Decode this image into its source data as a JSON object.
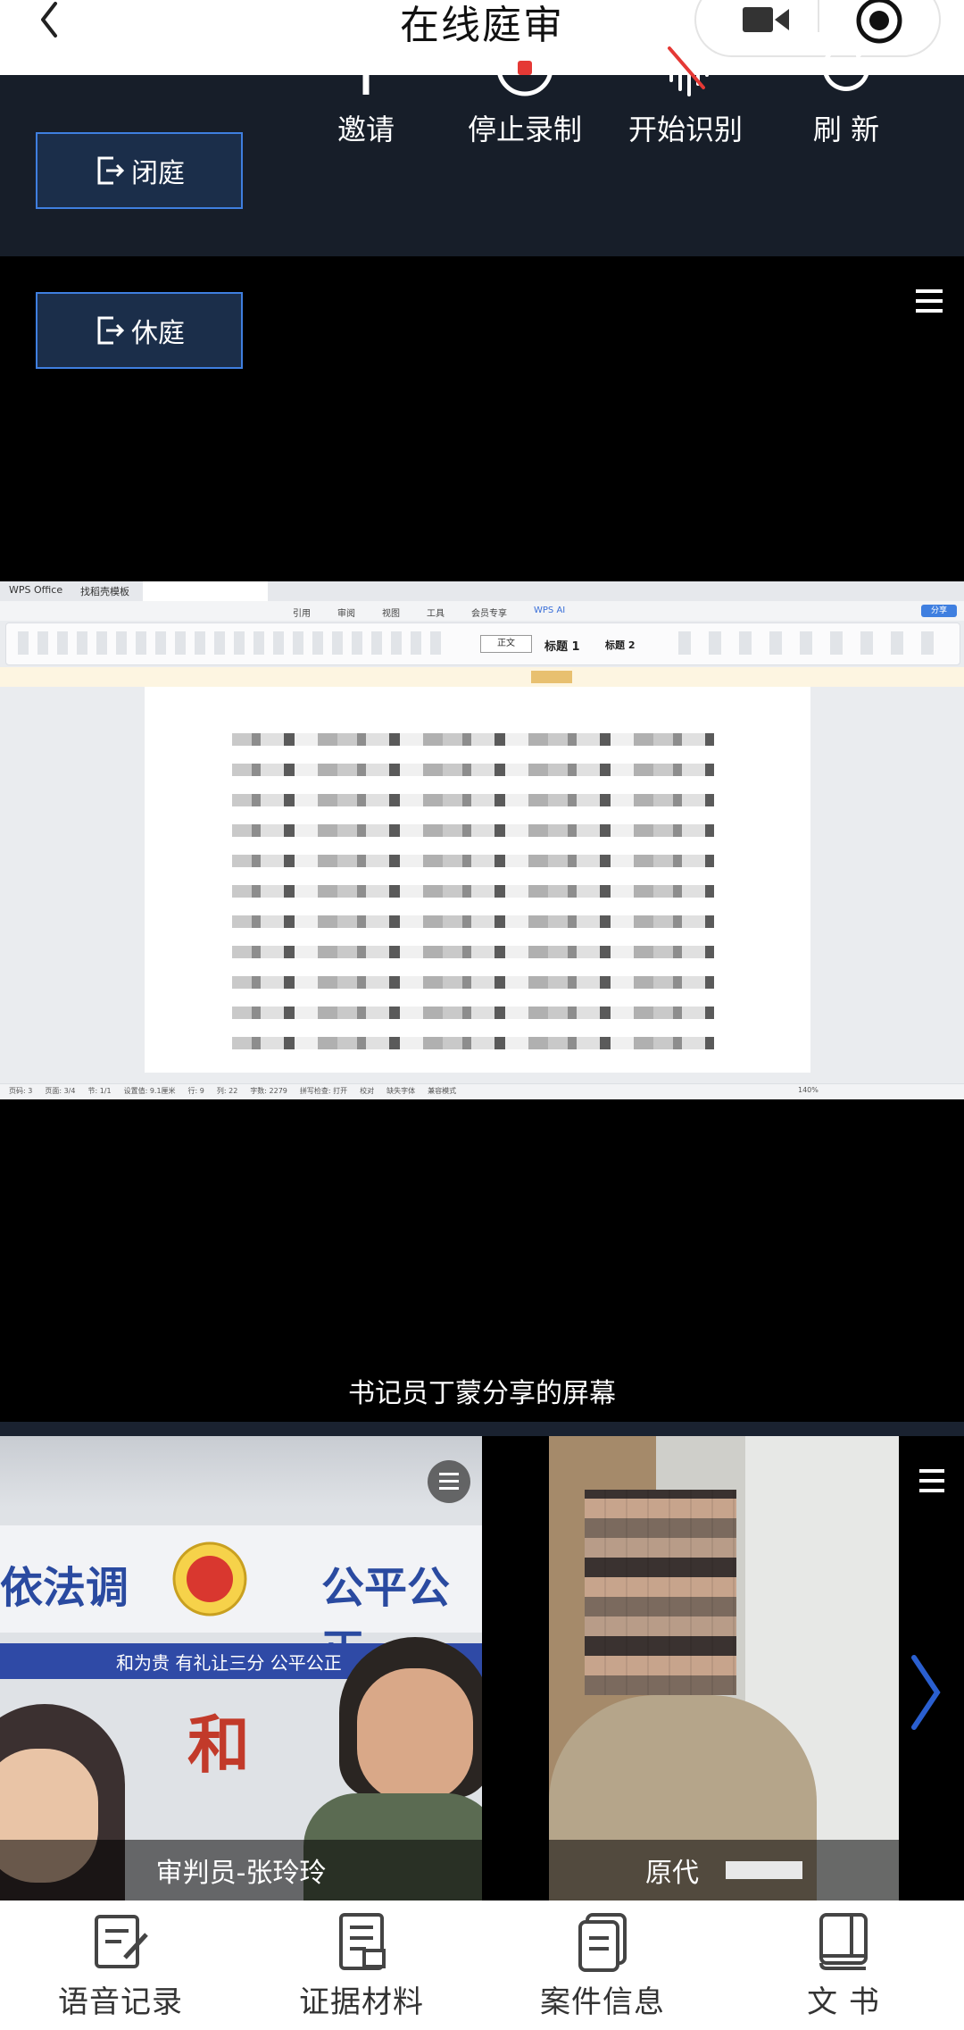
{
  "header": {
    "title": "在线庭审"
  },
  "toolbar": {
    "close_court": "闭庭",
    "recess": "休庭",
    "invite": "邀请",
    "stop_recording": "停止录制",
    "start_recognition": "开始识别",
    "refresh": "刷 新"
  },
  "shared_screen": {
    "caption": "书记员丁蒙分享的屏幕",
    "app_name": "WPS Office",
    "tab_template": "找稻壳模板",
    "menus": [
      "引用",
      "审阅",
      "视图",
      "工具",
      "会员专享",
      "WPS AI"
    ],
    "styles": [
      "正文",
      "标题 1",
      "标题 2"
    ],
    "share_button": "分享",
    "status_items": [
      "页码: 3",
      "页面: 3/4",
      "节: 1/1",
      "设置值: 9.1厘米",
      "行: 9",
      "列: 22",
      "字数: 2279",
      "拼写检查: 打开",
      "校对",
      "缺失字体",
      "兼容模式"
    ],
    "zoom": "140%"
  },
  "videos": [
    {
      "name": "审判员-张玲玲",
      "banner_left": "依法调",
      "banner_right": "公平公正",
      "banner_sub": "和为贵 有礼让三分 公平公正",
      "banner_he": "和"
    },
    {
      "name": "原代"
    }
  ],
  "bottom_nav": [
    "语音记录",
    "证据材料",
    "案件信息",
    "文 书"
  ],
  "colors": {
    "toolbar_bg": "#171e29",
    "accent": "#3f7fe0",
    "record_red": "#e53935"
  }
}
